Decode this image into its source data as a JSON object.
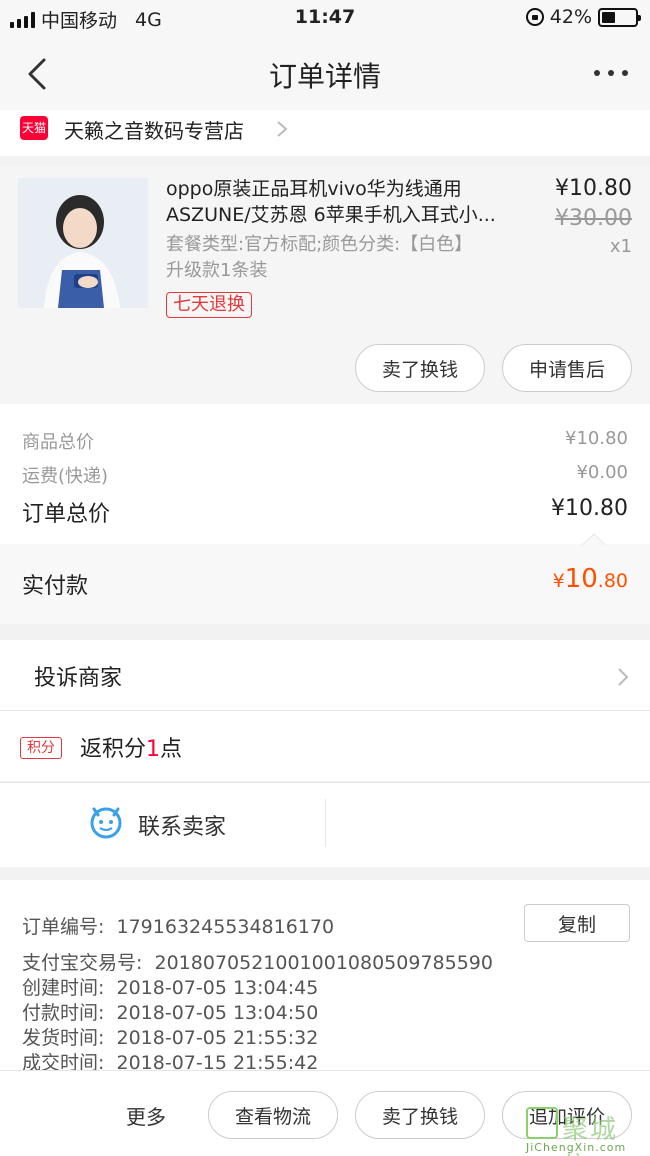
{
  "status_bar": {
    "carrier": "中国移动",
    "network": "4G",
    "time": "11:47",
    "battery_percent": "42%",
    "battery_level": 0.42
  },
  "nav": {
    "title": "订单详情"
  },
  "shop": {
    "badge": "天猫",
    "name": "天籁之音数码专营店"
  },
  "product": {
    "title_line1": "oppo原装正品耳机vivo华为线通用",
    "title_line2": "ASZUNE/艾苏恩 6苹果手机入耳式小...",
    "price": "¥10.80",
    "original_price": "¥30.00",
    "quantity": "x1",
    "sku_line1": "套餐类型:官方标配;颜色分类:【白色】",
    "sku_line2": "升级款1条装",
    "return_tag": "七天退换",
    "btn_sell": "卖了换钱",
    "btn_aftersale": "申请售后"
  },
  "summary": {
    "goods_label": "商品总价",
    "goods_value": "¥10.80",
    "shipping_label": "运费(快递)",
    "shipping_value": "¥0.00",
    "total_label": "订单总价",
    "total_value": "¥10.80",
    "paid_label": "实付款",
    "paid_currency": "¥",
    "paid_int": "10",
    "paid_dec": ".80"
  },
  "complaint": {
    "label": "投诉商家"
  },
  "points": {
    "badge": "积分",
    "prefix": "返积分",
    "value": "1",
    "suffix": "点"
  },
  "contact": {
    "label": "联系卖家"
  },
  "order_info": {
    "order_no_label": "订单编号:",
    "order_no": "179163245534816170",
    "copy_label": "复制",
    "alipay_label": "支付宝交易号:",
    "alipay_no": "2018070521001001080509785590",
    "created_label": "创建时间:",
    "created": "2018-07-05 13:04:45",
    "paid_label": "付款时间:",
    "paid": "2018-07-05 13:04:50",
    "shipped_label": "发货时间:",
    "shipped": "2018-07-05 21:55:32",
    "done_label": "成交时间:",
    "done": "2018-07-15 21:55:42"
  },
  "bottom": {
    "more": "更多",
    "logistics": "查看物流",
    "sell": "卖了换钱",
    "review": "追加评价",
    "watermark": "聚城信",
    "watermark_url": "JiChengXin.com"
  },
  "colors": {
    "accent_orange": "#ff5000",
    "tmall_red": "#ff0036",
    "tag_red": "#e4393c"
  }
}
